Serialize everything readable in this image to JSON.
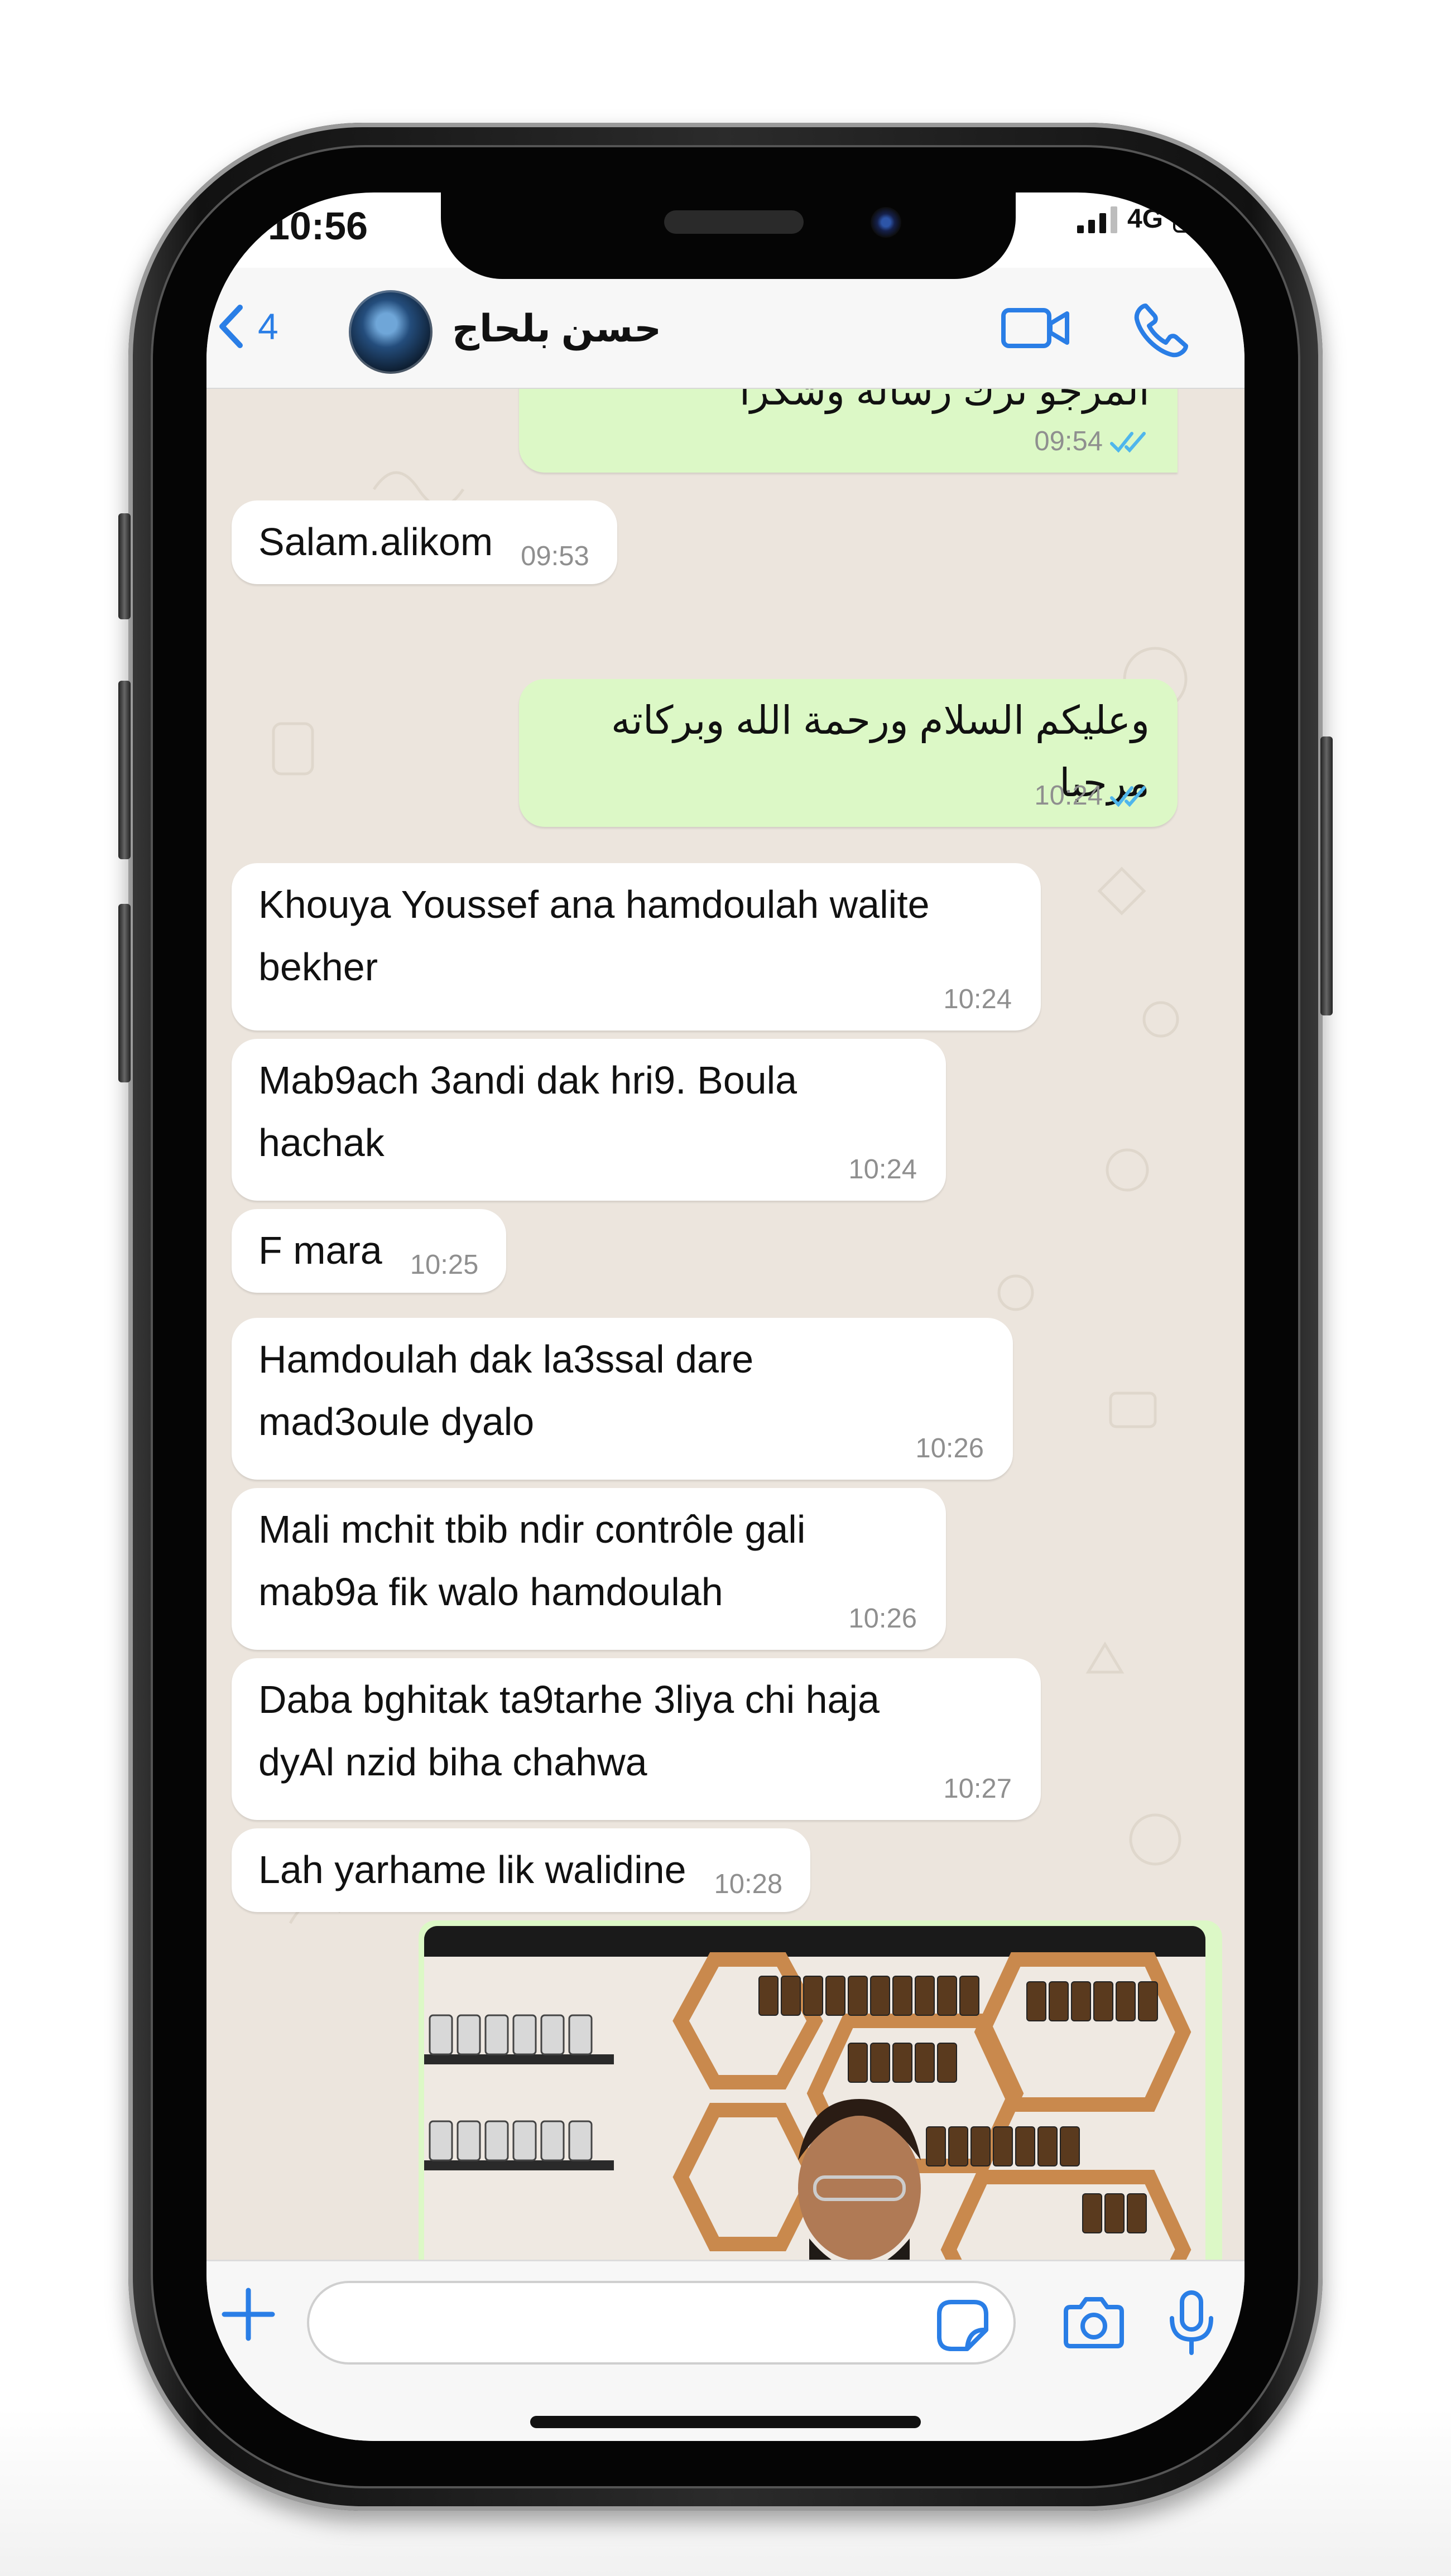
{
  "status_bar": {
    "time": "10:56",
    "network": "4G"
  },
  "header": {
    "back_count": "4",
    "contact_name": "حسن بلحاج",
    "icons": [
      "chevron-left-icon",
      "video-call-icon",
      "phone-icon"
    ]
  },
  "messages": [
    {
      "direction": "out",
      "text": "المرجو ترك رسالة وشكرا",
      "time": "09:54",
      "status": "read"
    },
    {
      "direction": "in",
      "text": "Salam.alikom",
      "time": "09:53"
    },
    {
      "direction": "out",
      "text": "وعليكم السلام ورحمة الله وبركاته مرحبا",
      "time": "10:24",
      "status": "read"
    },
    {
      "direction": "in",
      "text": "Khouya Youssef ana hamdoulah walite\nbekher",
      "time": "10:24"
    },
    {
      "direction": "in",
      "text": "Mab9ach 3andi dak hri9. Boula\nhachak",
      "time": "10:24"
    },
    {
      "direction": "in",
      "text": "F mara",
      "time": "10:25"
    },
    {
      "direction": "in",
      "text": "Hamdoulah dak la3ssal dare\nmad3oule dyalo",
      "time": "10:26"
    },
    {
      "direction": "in",
      "text": "Mali mchit tbib ndir contrôle gali\nmab9a fik walo hamdoulah",
      "time": "10:26"
    },
    {
      "direction": "in",
      "text": "Daba bghitak ta9tarhe 3liya chi haja\ndyAl nzid biha chahwa",
      "time": "10:27"
    },
    {
      "direction": "in",
      "text": "Lah yarhame lik walidine",
      "time": "10:28"
    }
  ],
  "media_message": {
    "direction": "out",
    "kind": "video-thumbnail"
  },
  "input_bar": {
    "placeholder": "",
    "icons": [
      "plus-icon",
      "sticker-icon",
      "camera-icon",
      "microphone-icon"
    ]
  },
  "colors": {
    "accent": "#2a7ee6",
    "incoming_bubble": "#ffffff",
    "outgoing_bubble": "#dcf8c6",
    "chat_background": "#ece5dd",
    "read_ticks": "#4fb6ec",
    "timestamp": "#8f8f8f"
  }
}
